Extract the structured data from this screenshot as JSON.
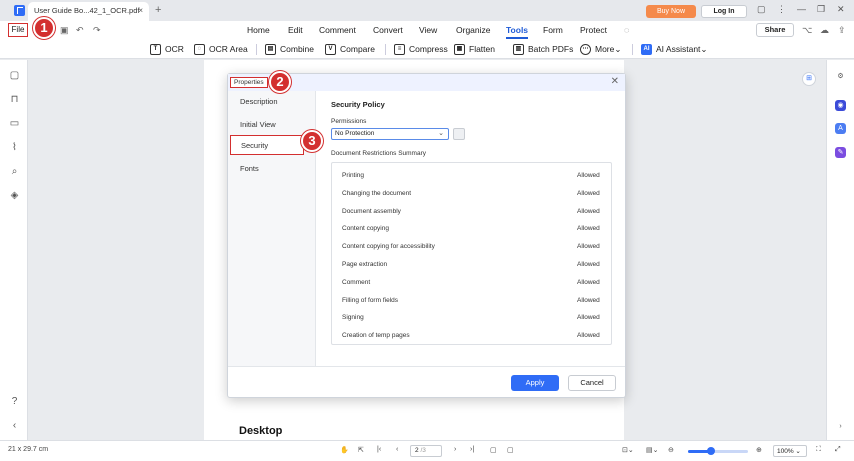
{
  "tab": {
    "title": "User Guide Bo...42_1_OCR.pdf",
    "close": "×",
    "new_tab": "+"
  },
  "header": {
    "buy_now": "Buy Now",
    "login": "Log In"
  },
  "menu": {
    "file": "File",
    "items": [
      "Home",
      "Edit",
      "Comment",
      "Convert",
      "View",
      "Organize",
      "Tools",
      "Form",
      "Protect"
    ],
    "active": "Tools",
    "share": "Share"
  },
  "tools": [
    "OCR",
    "OCR Area",
    "Combine",
    "Compare",
    "Compress",
    "Flatten",
    "Batch PDFs",
    "More",
    "AI Assistant"
  ],
  "dialog": {
    "title": "Properties",
    "nav": [
      "Description",
      "Initial View",
      "Security",
      "Fonts"
    ],
    "selected_nav": "Security",
    "section_title": "Security Policy",
    "permissions_label": "Permissions",
    "permissions_value": "No Protection",
    "summary_label": "Document Restrictions Summary",
    "restrictions": [
      {
        "name": "Printing",
        "status": "Allowed"
      },
      {
        "name": "Changing the document",
        "status": "Allowed"
      },
      {
        "name": "Document assembly",
        "status": "Allowed"
      },
      {
        "name": "Content copying",
        "status": "Allowed"
      },
      {
        "name": "Content copying for accessibility",
        "status": "Allowed"
      },
      {
        "name": "Page extraction",
        "status": "Allowed"
      },
      {
        "name": "Comment",
        "status": "Allowed"
      },
      {
        "name": "Filling of form fields",
        "status": "Allowed"
      },
      {
        "name": "Signing",
        "status": "Allowed"
      },
      {
        "name": "Creation of temp pages",
        "status": "Allowed"
      }
    ],
    "apply": "Apply",
    "cancel": "Cancel"
  },
  "page": {
    "heading": "Desktop"
  },
  "status": {
    "page_size": "21 x 29.7 cm",
    "page_number": "2",
    "page_total": "/3",
    "zoom": "100%",
    "zoom_level": 0.38
  },
  "steps": [
    "1",
    "2",
    "3"
  ],
  "colors": {
    "accent": "#2f6cf6",
    "annotation": "#d32f2f",
    "buy_now": "#f58a4b"
  }
}
